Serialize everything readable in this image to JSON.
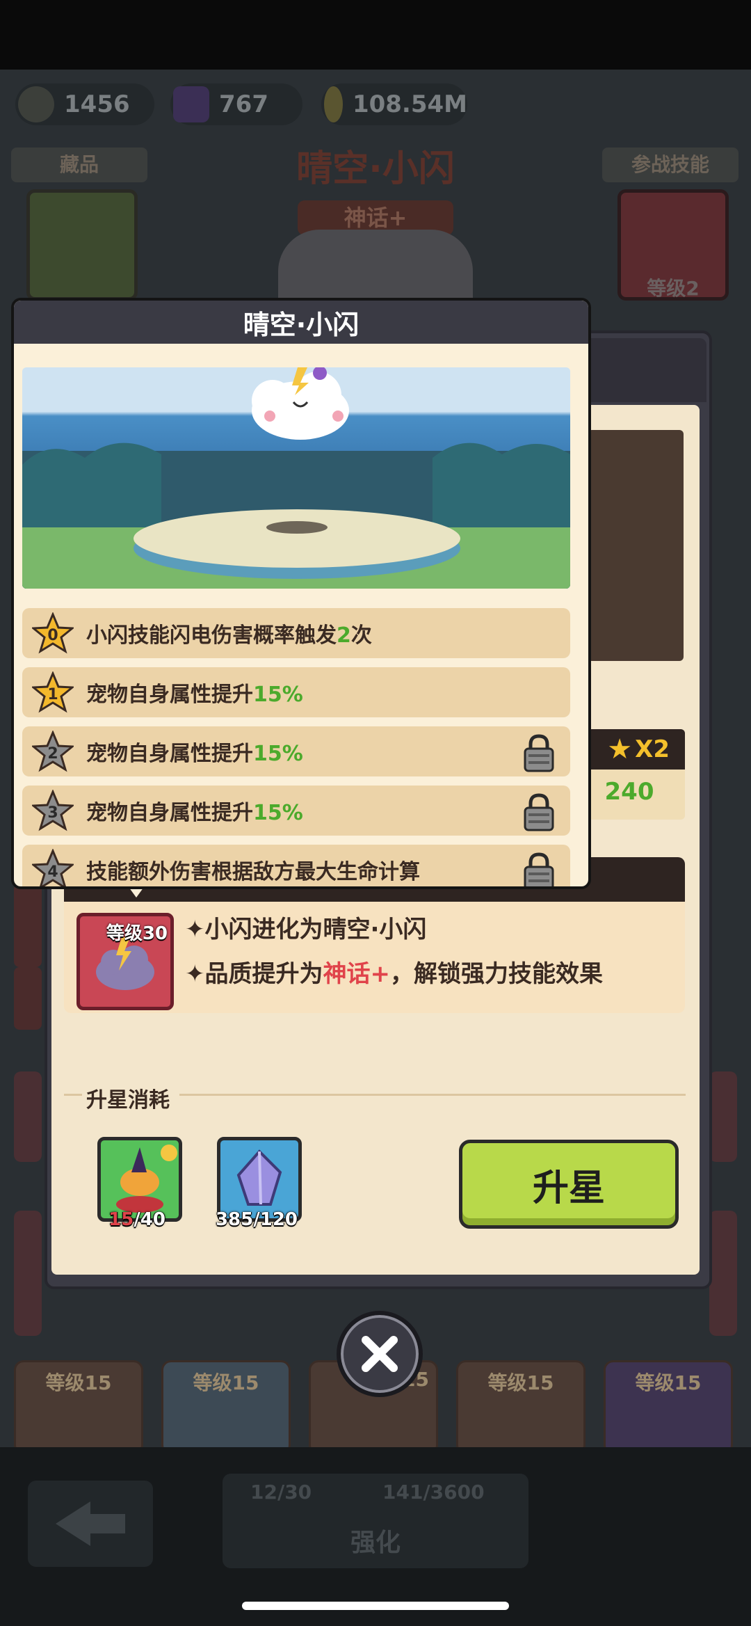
{
  "resources": [
    {
      "name": "pet-food",
      "value": "1456"
    },
    {
      "name": "gem",
      "value": "767"
    },
    {
      "name": "coin",
      "value": "108.54M"
    }
  ],
  "background": {
    "collection_tab": "藏品",
    "skills_tab": "参战技能",
    "pet_title": "晴空·小闪",
    "rarity_badge": "神话+",
    "skill_level": "等级2",
    "star_multiplier": "X2",
    "star_value": "240",
    "grid_levels": [
      "等级15",
      "等级15",
      "15",
      "等级15",
      "等级15"
    ],
    "enhance_label": "强化",
    "enhance_cost_1": "12/30",
    "enhance_cost_2": "141/3600"
  },
  "popup": {
    "title": "晴空·小闪",
    "star_rows": [
      {
        "star": "0",
        "text_before": "小闪技能闪电伤害概率触发",
        "highlight": "2",
        "text_after": "次",
        "locked": false
      },
      {
        "star": "1",
        "text_before": "宠物自身属性提升",
        "highlight": "15%",
        "text_after": "",
        "locked": false
      },
      {
        "star": "2",
        "text_before": "宠物自身属性提升",
        "highlight": "15%",
        "text_after": "",
        "locked": true
      },
      {
        "star": "3",
        "text_before": "宠物自身属性提升",
        "highlight": "15%",
        "text_after": "",
        "locked": true
      },
      {
        "star": "4",
        "text_before": "技能额外伤害根据敌方最大生命计算",
        "highlight": "",
        "text_after": "",
        "locked": true
      }
    ]
  },
  "evolution": {
    "icon_level": "等级30",
    "line1": "✦小闪进化为晴空·小闪",
    "line2_before": "✦品质提升为",
    "line2_highlight": "神话+",
    "line2_after": "，解锁强力技能效果"
  },
  "cost": {
    "title": "升星消耗",
    "item1_have": "15",
    "item1_need": "/40",
    "item2": "385/120",
    "button": "升星"
  },
  "colors": {
    "accent_green": "#4caa2c",
    "accent_red": "#e0434a",
    "button_green": "#b8d94a"
  }
}
